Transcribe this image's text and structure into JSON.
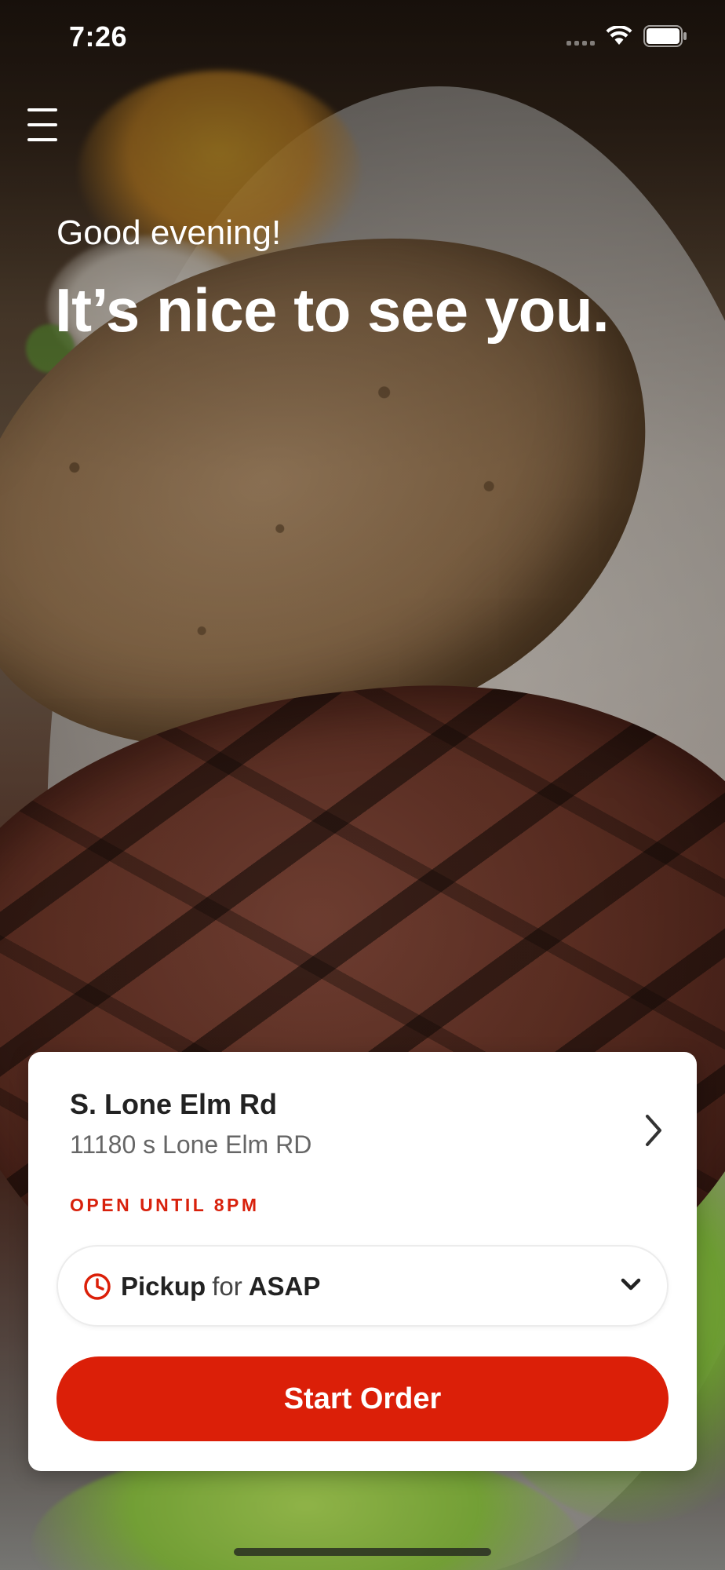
{
  "status_bar": {
    "time": "7:26",
    "signal_icon": "signal-dots-icon",
    "wifi_icon": "wifi-icon",
    "battery_icon": "battery-icon"
  },
  "header": {
    "menu_icon": "hamburger-menu-icon",
    "greeting": "Good evening!",
    "headline": "It’s nice to see you."
  },
  "location_card": {
    "location_name": "S. Lone Elm Rd",
    "address": "11180 s Lone Elm RD",
    "open_status": "OPEN UNTIL 8PM",
    "pickup": {
      "mode": "Pickup",
      "connector": "for",
      "time": "ASAP"
    },
    "start_order_label": "Start Order"
  },
  "colors": {
    "accent": "#db1f08",
    "open_status": "#d8210c",
    "card_background": "#ffffff",
    "text_primary": "#222222",
    "text_secondary": "#666666"
  }
}
